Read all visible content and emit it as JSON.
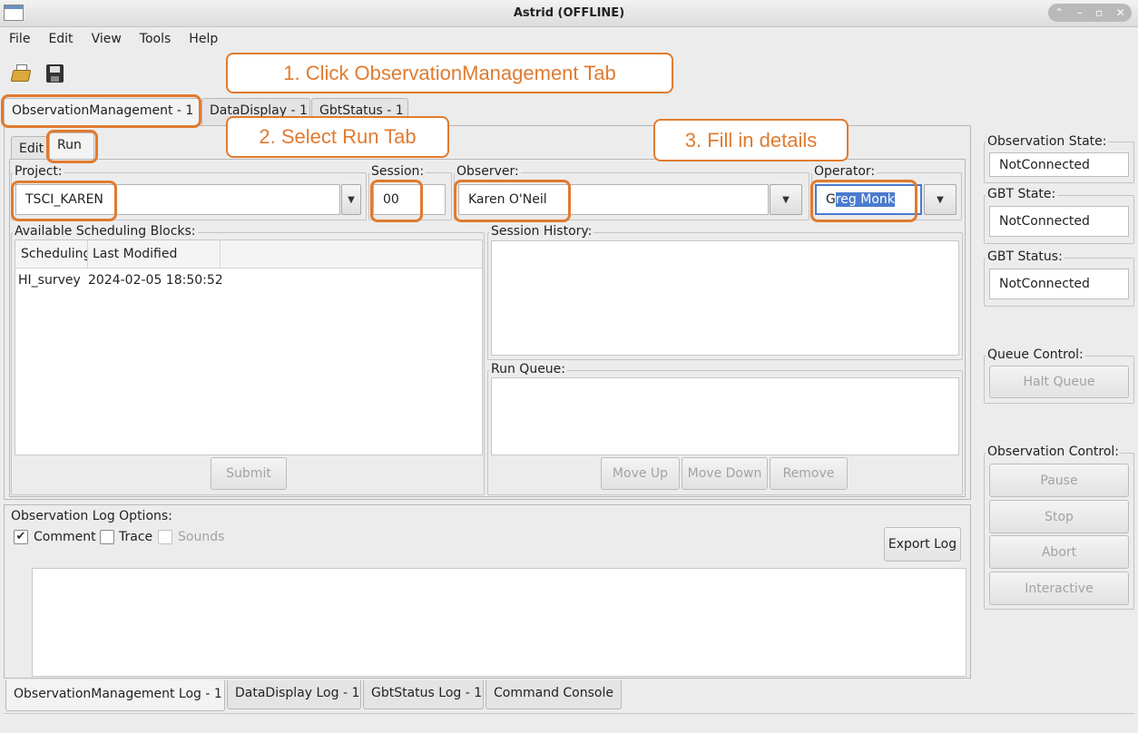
{
  "window": {
    "title": "Astrid (OFFLINE)",
    "controls": [
      "⌃",
      "–",
      "▫",
      "✕"
    ]
  },
  "menu": [
    "File",
    "Edit",
    "View",
    "Tools",
    "Help"
  ],
  "callouts": {
    "step1": "1. Click ObservationManagement Tab",
    "step2": "2. Select Run Tab",
    "step3": "3. Fill in details"
  },
  "main_tabs": [
    "ObservationManagement - 1",
    "DataDisplay - 1",
    "GbtStatus - 1"
  ],
  "sub_tabs": [
    "Edit",
    "Run"
  ],
  "form": {
    "project_label": "Project:",
    "project_value": "TSCI_KAREN",
    "session_label": "Session:",
    "session_value": "00",
    "observer_label": "Observer:",
    "observer_value": "Karen O'Neil",
    "operator_label": "Operator:",
    "operator_value_pre": "G",
    "operator_value_sel": "reg Monk"
  },
  "scheduling_blocks": {
    "label": "Available Scheduling Blocks:",
    "columns": [
      "Scheduling",
      "Last Modified",
      ""
    ],
    "rows": [
      {
        "name": "HI_survey",
        "modified": "2024-02-05 18:50:52"
      }
    ],
    "submit": "Submit"
  },
  "session_history": {
    "label": "Session History:"
  },
  "run_queue": {
    "label": "Run Queue:",
    "move_up": "Move Up",
    "move_down": "Move Down",
    "remove": "Remove"
  },
  "log_options": {
    "label": "Observation Log Options:",
    "comment": "Comment",
    "trace": "Trace",
    "sounds": "Sounds",
    "export": "Export Log"
  },
  "log_tabs": [
    "ObservationManagement Log - 1",
    "DataDisplay Log - 1",
    "GbtStatus Log - 1",
    "Command Console"
  ],
  "status": {
    "obs_state_label": "Observation State:",
    "obs_state": "NotConnected",
    "gbt_state_label": "GBT State:",
    "gbt_state": "NotConnected",
    "gbt_status_label": "GBT Status:",
    "gbt_status": "NotConnected"
  },
  "queue_control": {
    "label": "Queue Control:",
    "halt": "Halt Queue"
  },
  "observation_control": {
    "label": "Observation Control:",
    "pause": "Pause",
    "stop": "Stop",
    "abort": "Abort",
    "interactive": "Interactive"
  },
  "colors": {
    "accent": "#e07b2f",
    "selection": "#4a7bd0"
  }
}
